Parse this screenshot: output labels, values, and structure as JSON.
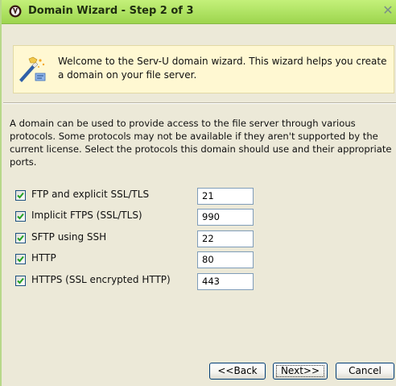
{
  "window": {
    "title": "Domain Wizard - Step 2 of 3",
    "close_glyph": "✕"
  },
  "banner": {
    "icon": "wizard-icon",
    "text": "Welcome to the Serv-U domain wizard. This wizard helps you create a domain on your file server."
  },
  "description": "A domain can be used to provide access to the file server through various protocols. Some protocols may not be available if they aren't supported by the current license. Select the protocols this domain should use and their appropriate ports.",
  "protocols": [
    {
      "label": "FTP and explicit SSL/TLS",
      "checked": true,
      "port": "21"
    },
    {
      "label": "Implicit FTPS (SSL/TLS)",
      "checked": true,
      "port": "990"
    },
    {
      "label": "SFTP using SSH",
      "checked": true,
      "port": "22"
    },
    {
      "label": "HTTP",
      "checked": true,
      "port": "80"
    },
    {
      "label": "HTTPS (SSL encrypted HTTP)",
      "checked": true,
      "port": "443"
    }
  ],
  "buttons": {
    "back": "<<Back",
    "next": "Next>>",
    "cancel": "Cancel"
  },
  "colors": {
    "titlebar": "#aee262",
    "banner_background": "#fff8d2",
    "dialog_background": "#ece9d8",
    "checkmark": "#21a121"
  }
}
